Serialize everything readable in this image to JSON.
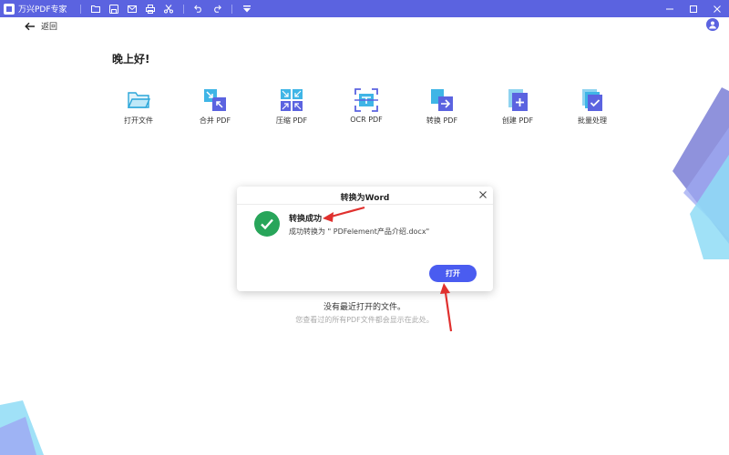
{
  "titlebar": {
    "app_title": "万兴PDF专家",
    "bg_color": "#5b63e0",
    "tools": [
      "folder-icon",
      "save-icon",
      "mail-icon",
      "print-icon",
      "scissors-icon",
      "undo-icon",
      "redo-icon",
      "dropdown-menu-icon"
    ]
  },
  "nav": {
    "back_label": "返回"
  },
  "home": {
    "greeting": "晚上好!",
    "tools": [
      {
        "label": "打开文件",
        "icon": "open-folder-icon"
      },
      {
        "label": "合并 PDF",
        "icon": "merge-pdf-icon"
      },
      {
        "label": "压缩 PDF",
        "icon": "compress-pdf-icon"
      },
      {
        "label": "OCR PDF",
        "icon": "ocr-pdf-icon"
      },
      {
        "label": "转换 PDF",
        "icon": "convert-pdf-icon"
      },
      {
        "label": "创建 PDF",
        "icon": "create-pdf-icon"
      },
      {
        "label": "批量处理",
        "icon": "batch-process-icon"
      }
    ]
  },
  "recent": {
    "empty_title": "没有最近打开的文件。",
    "empty_sub": "您查看过的所有PDF文件都会显示在此处。"
  },
  "dialog": {
    "title": "转换为Word",
    "success_title": "转换成功",
    "success_message": "成功转换为 \" PDFelement产品介绍.docx\"",
    "open_button": "打开",
    "accent_color": "#4a5cf0",
    "success_color": "#28a55a"
  }
}
